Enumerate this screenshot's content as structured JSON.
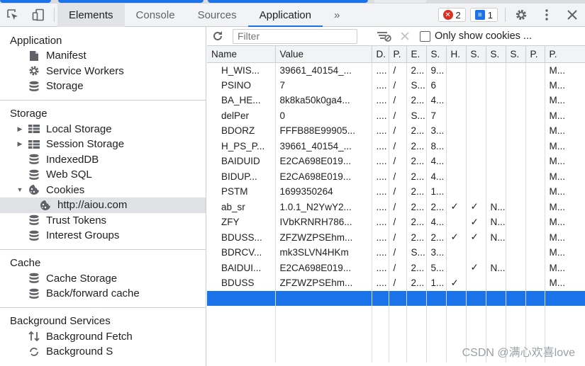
{
  "toolbar": {
    "tabs": [
      "Elements",
      "Console",
      "Sources",
      "Application"
    ],
    "more": "»",
    "errors_count": "2",
    "messages_count": "1"
  },
  "sidebar": {
    "application": {
      "title": "Application",
      "items": [
        {
          "label": "Manifest",
          "icon": "file-icon"
        },
        {
          "label": "Service Workers",
          "icon": "gear-icon"
        },
        {
          "label": "Storage",
          "icon": "database-icon"
        }
      ]
    },
    "storage": {
      "title": "Storage",
      "items": [
        {
          "label": "Local Storage",
          "icon": "table-icon",
          "arrow": "right"
        },
        {
          "label": "Session Storage",
          "icon": "table-icon",
          "arrow": "right"
        },
        {
          "label": "IndexedDB",
          "icon": "database-icon"
        },
        {
          "label": "Web SQL",
          "icon": "database-icon"
        },
        {
          "label": "Cookies",
          "icon": "cookie-icon",
          "arrow": "down"
        },
        {
          "label": "http://aiou.com",
          "icon": "cookie-icon",
          "selected": true
        },
        {
          "label": "Trust Tokens",
          "icon": "database-icon"
        },
        {
          "label": "Interest Groups",
          "icon": "database-icon"
        }
      ]
    },
    "cache": {
      "title": "Cache",
      "items": [
        {
          "label": "Cache Storage",
          "icon": "database-icon"
        },
        {
          "label": "Back/forward cache",
          "icon": "database-icon"
        }
      ]
    },
    "background": {
      "title": "Background Services",
      "items": [
        {
          "label": "Background Fetch",
          "icon": "arrows-icon"
        },
        {
          "label": "Background S",
          "icon": "sync-icon"
        }
      ]
    }
  },
  "filterbar": {
    "placeholder": "Filter",
    "only_show_label": "Only show cookies ..."
  },
  "cookies_table": {
    "headers": [
      "Name",
      "Value",
      "D.",
      "P.",
      "E.",
      "S.",
      "H.",
      "S.",
      "S.",
      "S.",
      "P.",
      "P."
    ],
    "rows": [
      [
        "H_WIS...",
        "39661_40154_...",
        "....",
        "/",
        "2...",
        "9...",
        "",
        "",
        "",
        "",
        "",
        "M..."
      ],
      [
        "PSINO",
        "7",
        "....",
        "/",
        "S...",
        "6",
        "",
        "",
        "",
        "",
        "",
        "M..."
      ],
      [
        "BA_HE...",
        "8k8ka50k0ga4...",
        "....",
        "/",
        "2...",
        "4...",
        "",
        "",
        "",
        "",
        "",
        "M..."
      ],
      [
        "delPer",
        "0",
        "....",
        "/",
        "S...",
        "7",
        "",
        "",
        "",
        "",
        "",
        "M..."
      ],
      [
        "BDORZ",
        "FFFB88E99905...",
        "....",
        "/",
        "2...",
        "3...",
        "",
        "",
        "",
        "",
        "",
        "M..."
      ],
      [
        "H_PS_P...",
        "39661_40154_...",
        "....",
        "/",
        "2...",
        "8...",
        "",
        "",
        "",
        "",
        "",
        "M..."
      ],
      [
        "BAIDUID",
        "E2CA698E019...",
        "....",
        "/",
        "2...",
        "4...",
        "",
        "",
        "",
        "",
        "",
        "M..."
      ],
      [
        "BIDUP...",
        "E2CA698E019...",
        "....",
        "/",
        "2...",
        "4...",
        "",
        "",
        "",
        "",
        "",
        "M..."
      ],
      [
        "PSTM",
        "1699350264",
        "....",
        "/",
        "2...",
        "1...",
        "",
        "",
        "",
        "",
        "",
        "M..."
      ],
      [
        "ab_sr",
        "1.0.1_N2YwY2...",
        "....",
        "/",
        "2...",
        "2...",
        "✓",
        "✓",
        "N...",
        "",
        "",
        "M..."
      ],
      [
        "ZFY",
        "IVbKRNRH786...",
        "....",
        "/",
        "2...",
        "4...",
        "",
        "✓",
        "N...",
        "",
        "",
        "M..."
      ],
      [
        "BDUSS...",
        "ZFZWZPSEhm...",
        "....",
        "/",
        "2...",
        "2...",
        "✓",
        "✓",
        "N...",
        "",
        "",
        "M..."
      ],
      [
        "BDRCV...",
        "mk3SLVN4HKm",
        "....",
        "/",
        "S...",
        "3...",
        "",
        "",
        "",
        "",
        "",
        "M..."
      ],
      [
        "BAIDUI...",
        "E2CA698E019...",
        "....",
        "/",
        "2...",
        "5...",
        "",
        "✓",
        "N...",
        "",
        "",
        "M..."
      ],
      [
        "BDUSS",
        "ZFZWZPSEhm...",
        "....",
        "/",
        "2...",
        "1...",
        "✓",
        "",
        "",
        "",
        "",
        "M..."
      ]
    ]
  },
  "watermark": "CSDN @满心欢喜love",
  "colors": {
    "accent": "#1a73e8",
    "error": "#d93025"
  }
}
